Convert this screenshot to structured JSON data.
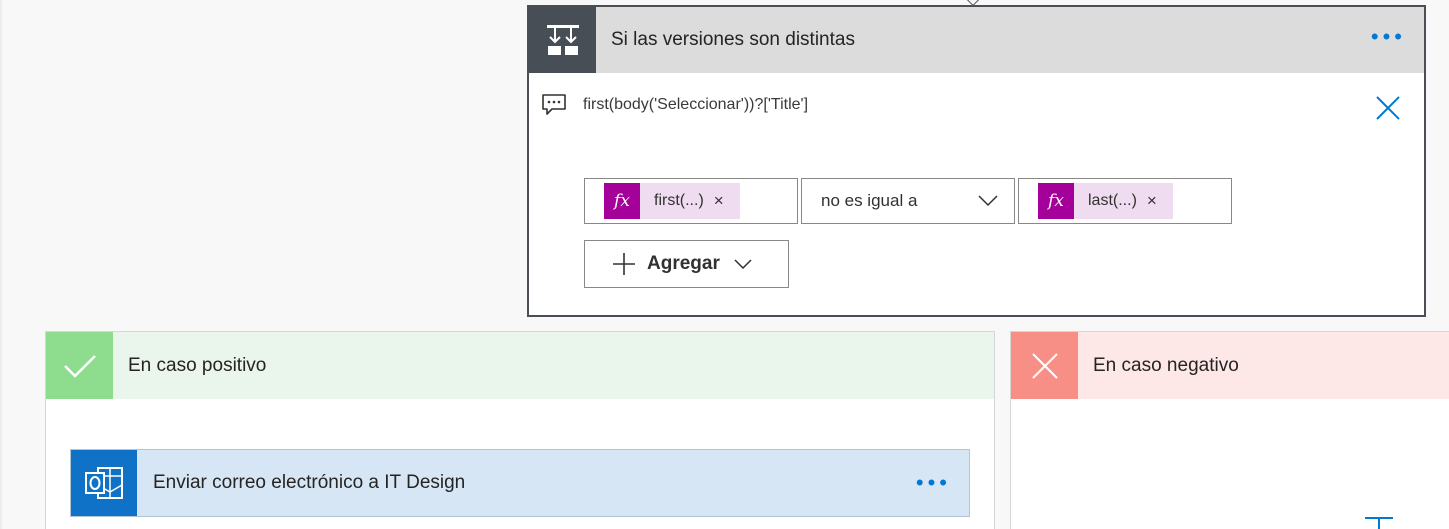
{
  "condition": {
    "title": "Si las versiones son distintas",
    "more_label": "•••",
    "expression": "first(body('Seleccionar'))?['Title']",
    "left_operand": {
      "fx_label": "fx",
      "label": "first(...)",
      "remove": "×"
    },
    "operator": "no es igual a",
    "right_operand": {
      "fx_label": "fx",
      "label": "last(...)",
      "remove": "×"
    },
    "add_button": "Agregar"
  },
  "branches": {
    "positive": {
      "title": "En caso positivo",
      "action": {
        "title": "Enviar correo electrónico a IT Design",
        "more_label": "•••"
      }
    },
    "negative": {
      "title": "En caso negativo"
    }
  },
  "colors": {
    "accent": "#0078d4",
    "condition_header": "#474e56",
    "expression_token": "#a4009a",
    "positive": "#8edc8e",
    "negative": "#f78f87",
    "outlook": "#0f72c6"
  }
}
